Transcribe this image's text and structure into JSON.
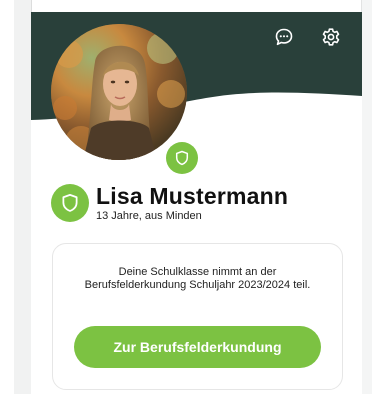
{
  "header": {
    "background_color": "#29403a",
    "chat_icon": "chat-bubble-icon",
    "settings_icon": "gear-icon"
  },
  "profile": {
    "avatar": "profile-photo",
    "verified_icon": "shield-icon",
    "name": "Lisa Mustermann",
    "subtitle": "13 Jahre, aus Minden"
  },
  "card": {
    "message": "Deine Schulklasse nimmt an der Berufsfelderkundung Schuljahr 2023/2024 teil.",
    "button_label": "Zur Berufsfelderkundung"
  },
  "colors": {
    "accent": "#7cc242",
    "header": "#29403a",
    "text": "#111111"
  }
}
